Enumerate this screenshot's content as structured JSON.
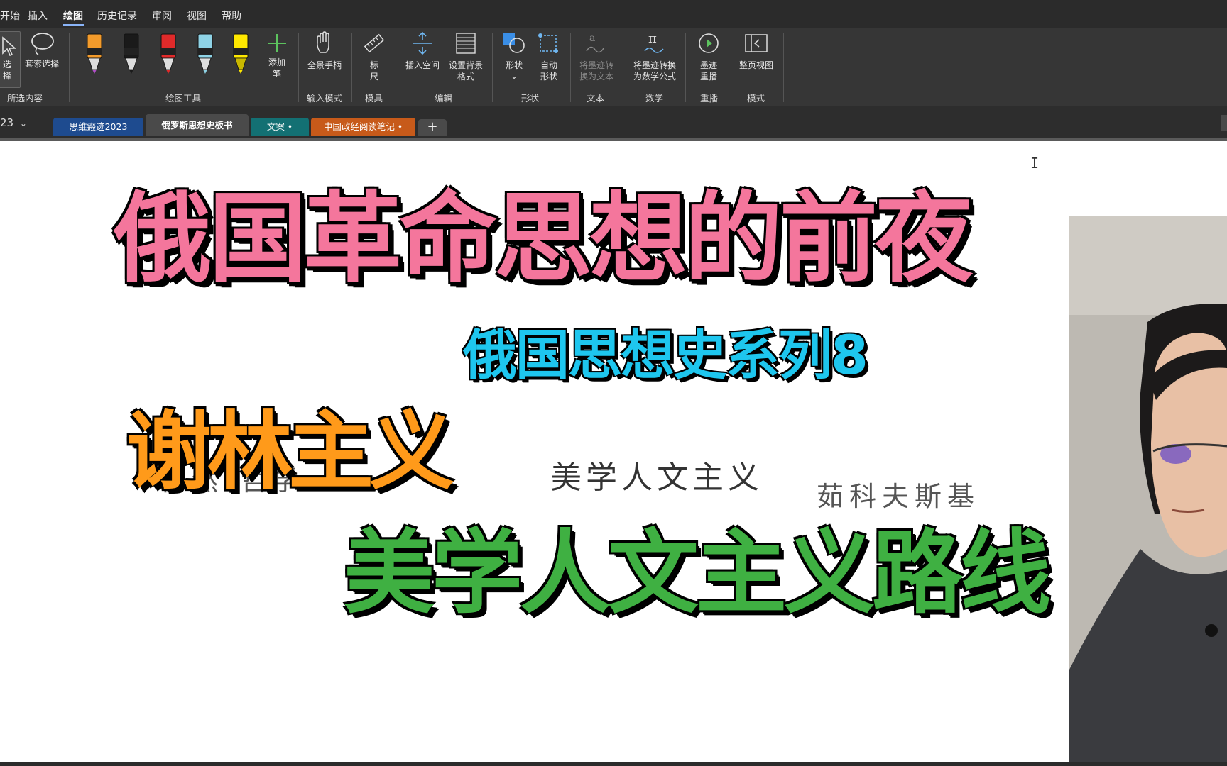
{
  "menu": {
    "items": [
      "开始",
      "插入",
      "绘图",
      "历史记录",
      "审阅",
      "视图",
      "帮助"
    ],
    "active": "绘图"
  },
  "ribbon": {
    "select": "选\n择",
    "lasso": "套索选择",
    "add_pen": "添加\n笔",
    "full_screen_hand": "全景手柄",
    "ruler": "标\n尺",
    "insert_space": "插入空间",
    "set_background": "设置背景\n格式",
    "shapes": "形状",
    "auto_shapes": "自动\n形状",
    "ink_to_text": "将墨迹转\n换为文本",
    "ink_to_math": "将墨迹转换\n为数学公式",
    "ink_replay": "墨迹\n重播",
    "page_view": "整页视图",
    "groups": {
      "selection": "所选内容",
      "drawing_tools": "绘图工具",
      "input_mode": "输入模式",
      "stencils": "模具",
      "edit": "编辑",
      "shapes": "形状",
      "text": "文本",
      "math": "数学",
      "replay": "重播",
      "mode": "模式"
    },
    "pen_colors": [
      "#f39b2b",
      "#1a1a1a",
      "#e02a2a",
      "#8fd3e6",
      "#ffe800"
    ]
  },
  "notebook": {
    "name_fragment": "23",
    "tabs": [
      {
        "label": "思维瘢迹2023",
        "color": "#1e4b8f"
      },
      {
        "label": "俄罗斯思想史板书",
        "color": "#4a4a4a"
      },
      {
        "label": "文案 •",
        "color": "#137073"
      },
      {
        "label": "中国政经阅读笔记 •",
        "color": "#c75a1a"
      }
    ],
    "add_tab": "+"
  },
  "page": {
    "title": "俄国革命思想的前夜",
    "subtitle": "俄国思想史系列8",
    "topic": "谢林主义",
    "route": "美学人文主义路线",
    "ink_nature": "“自然”哲学",
    "ink_zhukovsky": "茹科夫斯基",
    "ink_aesthetic": "美学人文主义",
    "ink_fragment": "如"
  }
}
